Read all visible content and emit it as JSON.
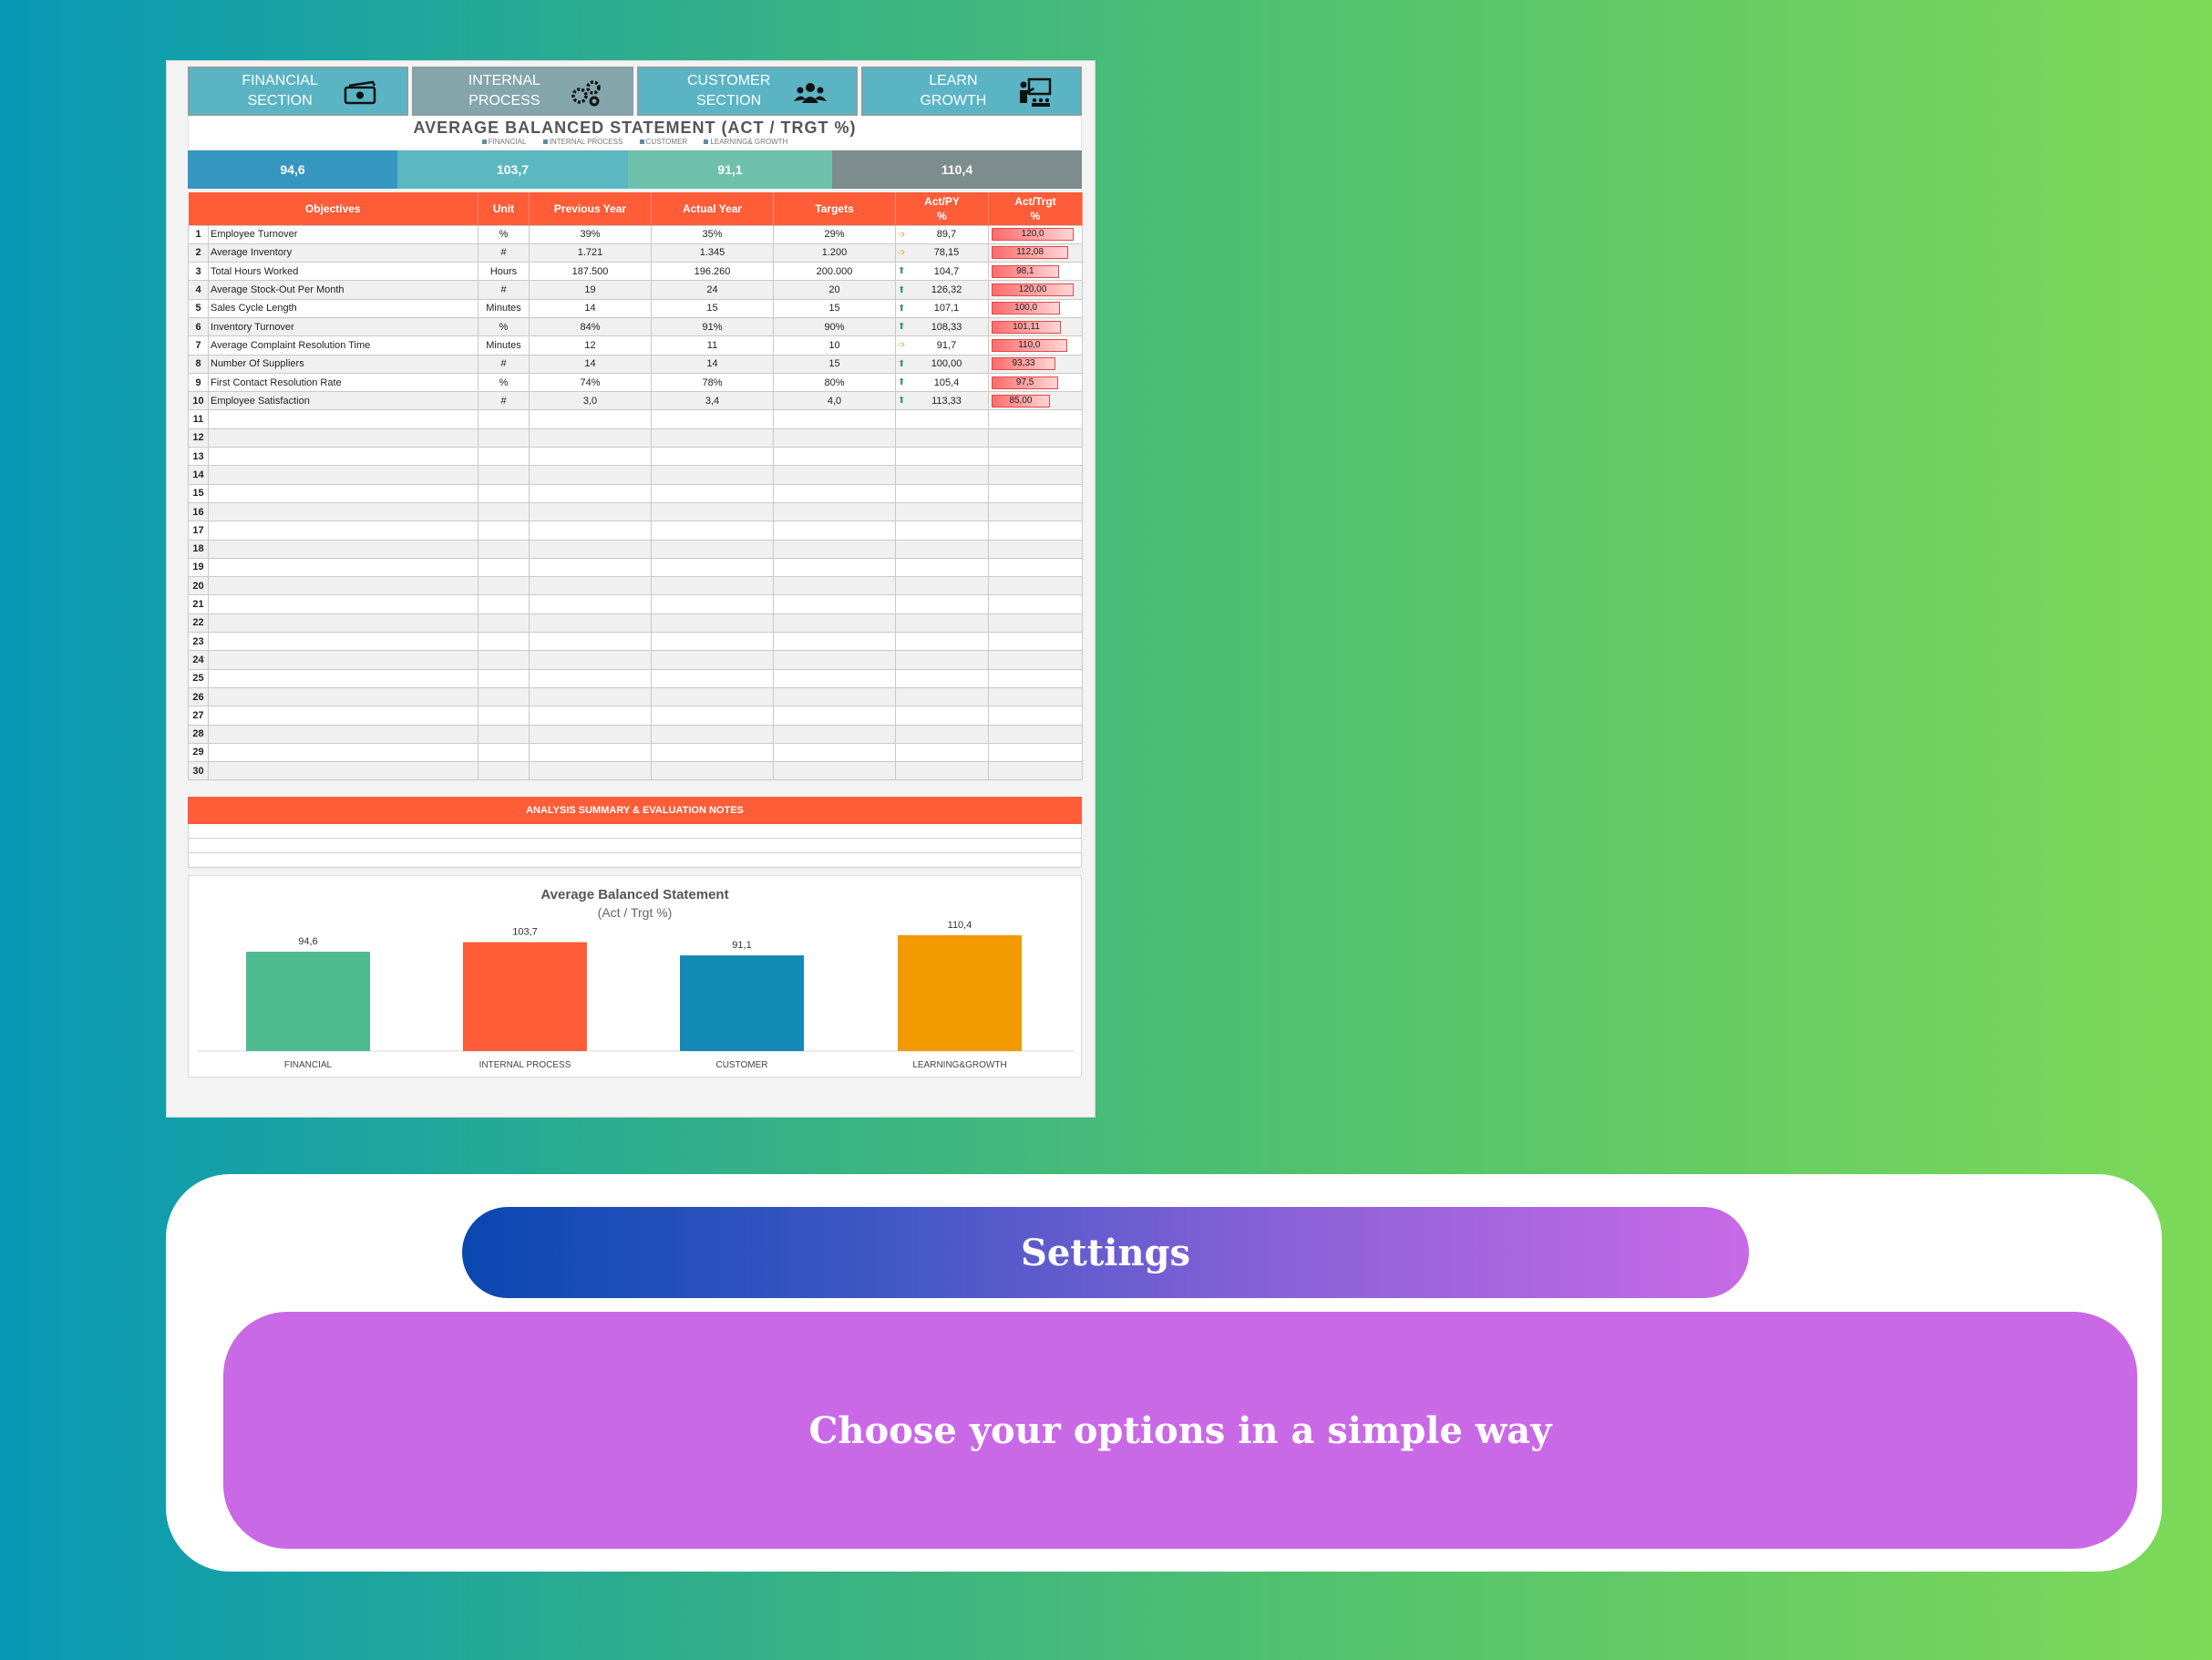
{
  "nav": [
    {
      "line1": "FINANCIAL",
      "line2": "SECTION",
      "icon": "money-icon",
      "color": "#5ab4c4"
    },
    {
      "line1": "INTERNAL",
      "line2": "PROCESS",
      "icon": "gears-icon",
      "color": "#84a6ab"
    },
    {
      "line1": "CUSTOMER",
      "line2": "SECTION",
      "icon": "people-icon",
      "color": "#5ab4c4"
    },
    {
      "line1": "LEARN",
      "line2": "GROWTH",
      "icon": "teacher-icon",
      "color": "#5ab4c4"
    }
  ],
  "header": {
    "title": "AVERAGE BALANCED STATEMENT (ACT / TRGT %)",
    "legend": [
      "FINANCIAL",
      "INTERNAL PROCESS",
      "CUSTOMER",
      "LEARNING& GROWTH"
    ]
  },
  "scores": [
    "94,6",
    "103,7",
    "91,1",
    "110,4"
  ],
  "table": {
    "headers": [
      "Objectives",
      "Unit",
      "Previous Year",
      "Actual Year",
      "Targets",
      "Act/PY %",
      "Act/Trgt %"
    ],
    "rows": [
      {
        "n": "1",
        "obj": "Employee Turnover",
        "unit": "%",
        "py": "39%",
        "ay": "35%",
        "tg": "29%",
        "dir": "right",
        "apy": "89,7",
        "atg": "120,0",
        "atg_val": 120.0
      },
      {
        "n": "2",
        "obj": "Average Inventory",
        "unit": "#",
        "py": "1.721",
        "ay": "1.345",
        "tg": "1.200",
        "dir": "right",
        "apy": "78,15",
        "atg": "112,08",
        "atg_val": 112.08
      },
      {
        "n": "3",
        "obj": "Total Hours Worked",
        "unit": "Hours",
        "py": "187.500",
        "ay": "196.260",
        "tg": "200.000",
        "dir": "up",
        "apy": "104,7",
        "atg": "98,1",
        "atg_val": 98.1
      },
      {
        "n": "4",
        "obj": "Average Stock-Out Per Month",
        "unit": "#",
        "py": "19",
        "ay": "24",
        "tg": "20",
        "dir": "up",
        "apy": "126,32",
        "atg": "120,00",
        "atg_val": 120.0
      },
      {
        "n": "5",
        "obj": "Sales Cycle Length",
        "unit": "Minutes",
        "py": "14",
        "ay": "15",
        "tg": "15",
        "dir": "up",
        "apy": "107,1",
        "atg": "100,0",
        "atg_val": 100.0
      },
      {
        "n": "6",
        "obj": "Inventory Turnover",
        "unit": "%",
        "py": "84%",
        "ay": "91%",
        "tg": "90%",
        "dir": "up",
        "apy": "108,33",
        "atg": "101,11",
        "atg_val": 101.11
      },
      {
        "n": "7",
        "obj": "Average Complaint Resolution Time",
        "unit": "Minutes",
        "py": "12",
        "ay": "11",
        "tg": "10",
        "dir": "right",
        "apy": "91,7",
        "atg": "110,0",
        "atg_val": 110.0
      },
      {
        "n": "8",
        "obj": "Number Of Suppliers",
        "unit": "#",
        "py": "14",
        "ay": "14",
        "tg": "15",
        "dir": "up",
        "apy": "100,00",
        "atg": "93,33",
        "atg_val": 93.33
      },
      {
        "n": "9",
        "obj": "First Contact Resolution Rate",
        "unit": "%",
        "py": "74%",
        "ay": "78%",
        "tg": "80%",
        "dir": "up",
        "apy": "105,4",
        "atg": "97,5",
        "atg_val": 97.5
      },
      {
        "n": "10",
        "obj": "Employee Satisfaction",
        "unit": "#",
        "py": "3,0",
        "ay": "3,4",
        "tg": "4,0",
        "dir": "up",
        "apy": "113,33",
        "atg": "85,00",
        "atg_val": 85.0
      }
    ],
    "empty_rows": [
      "11",
      "12",
      "13",
      "14",
      "15",
      "16",
      "17",
      "18",
      "19",
      "20",
      "21",
      "22",
      "23",
      "24",
      "25",
      "26",
      "27",
      "28",
      "29",
      "30"
    ]
  },
  "summary": {
    "title": "ANALYSIS SUMMARY & EVALUATION NOTES"
  },
  "chart_data": {
    "type": "bar",
    "title": "Average Balanced Statement",
    "subtitle": "(Act / Trgt %)",
    "categories": [
      "FINANCIAL",
      "INTERNAL PROCESS",
      "CUSTOMER",
      "LEARNING&GROWTH"
    ],
    "values": [
      94.6,
      103.7,
      91.1,
      110.4
    ],
    "labels": [
      "94,6",
      "103,7",
      "91,1",
      "110,4"
    ],
    "colors": [
      "#4dbb8f",
      "#ff5c38",
      "#128ab5",
      "#f29a00"
    ],
    "ylim": [
      0,
      120
    ],
    "grid": false
  },
  "settings": {
    "title": "Settings",
    "subtitle": "Choose your options in a simple way"
  }
}
